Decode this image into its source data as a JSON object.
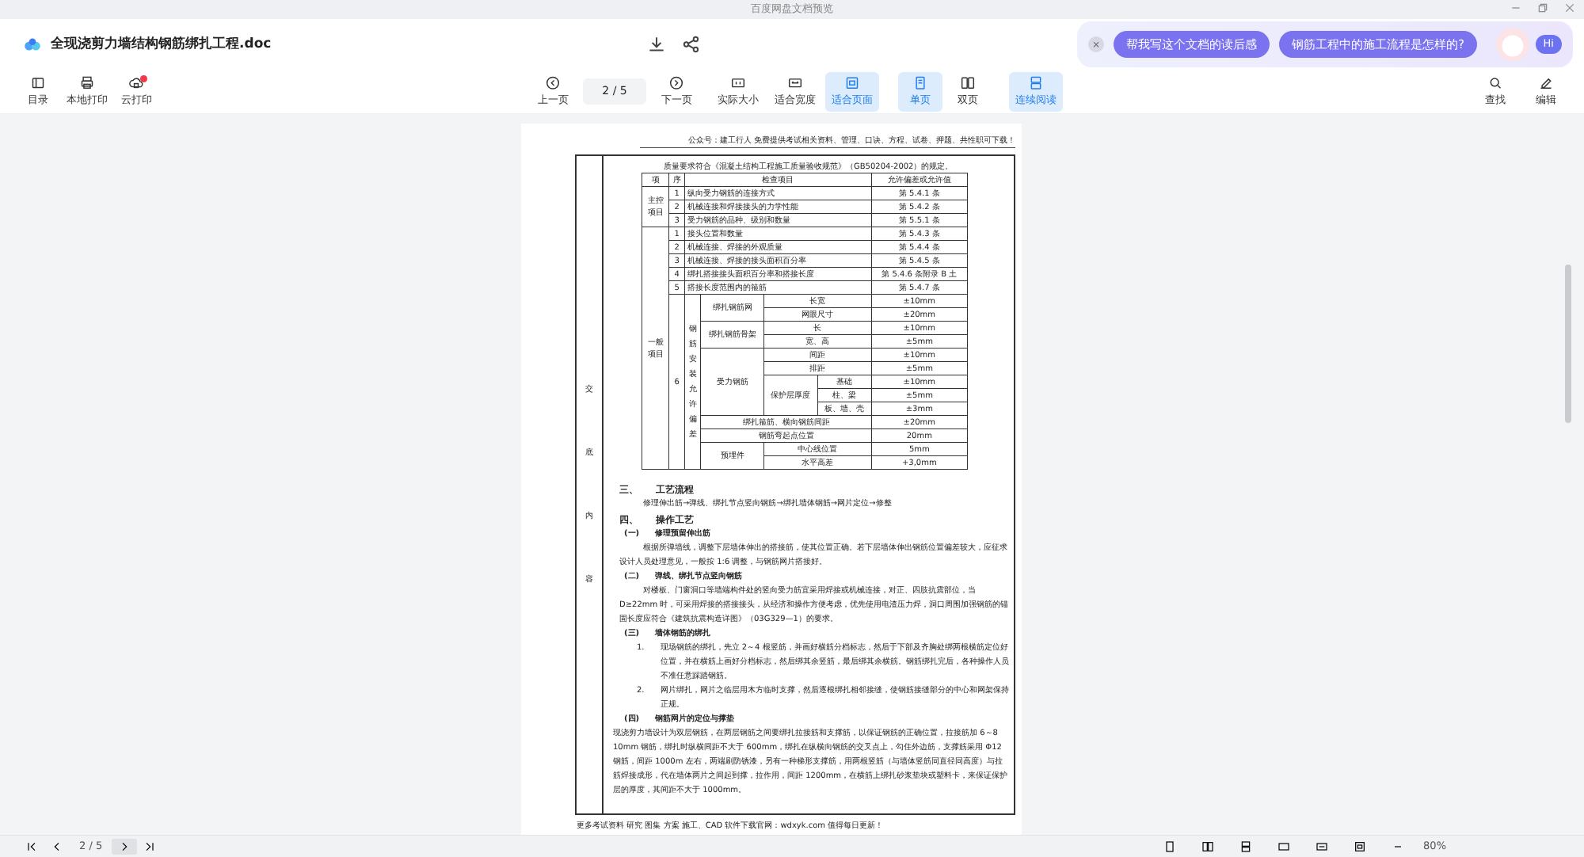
{
  "window": {
    "title": "百度网盘文档预览"
  },
  "file": {
    "name": "全现浇剪力墙结构钢筋绑扎工程.doc"
  },
  "assistant": {
    "close": "×",
    "suggestions": [
      "帮我写这个文档的读后感",
      "钢筋工程中的施工流程是怎样的?"
    ],
    "greeting": "Hi"
  },
  "toolbar": {
    "left": [
      {
        "label": "目录",
        "notification": false
      },
      {
        "label": "本地打印",
        "notification": false
      },
      {
        "label": "云打印",
        "notification": true
      }
    ],
    "nav": {
      "prev": "上一页",
      "page": "2 / 5",
      "next": "下一页"
    },
    "view": [
      {
        "label": "实际大小",
        "selected": false
      },
      {
        "label": "适合宽度",
        "selected": false
      },
      {
        "label": "适合页面",
        "selected": true
      }
    ],
    "layout": [
      {
        "label": "单页",
        "selected": true
      },
      {
        "label": "双页",
        "selected": false
      }
    ],
    "continuous": {
      "label": "连续阅读",
      "selected": true
    },
    "right": [
      {
        "label": "查找"
      },
      {
        "label": "编辑"
      }
    ]
  },
  "document": {
    "header_note": "公众号：建工行人 免费提供考试相关资料、管理、口诀、方程、试卷、押题、共性职可下载！",
    "side_label": "交底内容",
    "quality_table": {
      "caption": "质量要求符合《混凝土结构工程施工质量验收规范》（GB50204-2002）的规定。",
      "columns": [
        "项",
        "序",
        "检查项目",
        "允许偏差或允许值"
      ],
      "groups": [
        {
          "name": "主控项目",
          "items": [
            {
              "seq": "1",
              "item": "纵向受力钢筋的连接方式",
              "value": "第 5.4.1 条"
            },
            {
              "seq": "2",
              "item": "机械连接和焊接接头的力学性能",
              "value": "第 5.4.2 条"
            },
            {
              "seq": "3",
              "item": "受力钢筋的品种、级别和数量",
              "value": "第 5.5.1 条"
            }
          ]
        },
        {
          "name": "一般项目",
          "items": [
            {
              "seq": "1",
              "item": "接头位置和数量",
              "value": "第 5.4.3 条"
            },
            {
              "seq": "2",
              "item": "机械连接、焊接的外观质量",
              "value": "第 5.4.4 条"
            },
            {
              "seq": "3",
              "item": "机械连接、焊接的接头面积百分率",
              "value": "第 5.4.5 条"
            },
            {
              "seq": "4",
              "item": "绑扎搭接接头面积百分率和搭接长度",
              "value": "第 5.4.6 条附录 B 土"
            },
            {
              "seq": "5",
              "item": "搭接长度范围内的箍筋",
              "value": "第 5.4.7 条"
            },
            {
              "seq": "6",
              "item": "钢筋安装允许偏差",
              "children": [
                {
                  "item": "绑扎钢筋网",
                  "children": [
                    {
                      "item": "长宽",
                      "value": "±10mm"
                    },
                    {
                      "item": "网眼尺寸",
                      "value": "±20mm"
                    }
                  ]
                },
                {
                  "item": "绑扎钢筋骨架",
                  "children": [
                    {
                      "item": "长",
                      "value": "±10mm"
                    },
                    {
                      "item": "宽、高",
                      "value": "±5mm"
                    }
                  ]
                },
                {
                  "item": "受力钢筋",
                  "children": [
                    {
                      "item": "间距",
                      "value": "±10mm"
                    },
                    {
                      "item": "排距",
                      "value": "±5mm"
                    },
                    {
                      "item": "保护层厚度",
                      "children": [
                        {
                          "item": "基础",
                          "value": "±10mm"
                        },
                        {
                          "item": "柱、梁",
                          "value": "±5mm"
                        },
                        {
                          "item": "板、墙、壳",
                          "value": "±3mm"
                        }
                      ]
                    }
                  ]
                },
                {
                  "item": "绑扎箍筋、横向钢筋间距",
                  "value": "±20mm"
                },
                {
                  "item": "钢筋弯起点位置",
                  "value": "20mm"
                },
                {
                  "item": "预埋件",
                  "children": [
                    {
                      "item": "中心线位置",
                      "value": "5mm"
                    },
                    {
                      "item": "水平高差",
                      "value": "+3,0mm"
                    }
                  ]
                }
              ]
            }
          ]
        }
      ]
    },
    "sections": [
      {
        "kind": "heading",
        "number": "三、",
        "title": "工艺流程"
      },
      {
        "kind": "paragraph",
        "text": "修理伸出筋→弹线、绑扎节点竖向钢筋→绑扎墙体钢筋→网片定位→修整"
      },
      {
        "kind": "heading",
        "number": "四、",
        "title": "操作工艺"
      },
      {
        "kind": "subheading",
        "number": "(一)",
        "title": "修理预留伸出筋"
      },
      {
        "kind": "paragraph",
        "text": "根据所弹墙线，调整下层墙体伸出的搭接筋，使其位置正确。若下层墙体伸出钢筋位置偏差较大，应征求设计人员处理意见，一般按 1:6 调整，与钢筋网片搭接好。"
      },
      {
        "kind": "subheading",
        "number": "(二)",
        "title": "弹线、绑扎节点竖向钢筋"
      },
      {
        "kind": "paragraph",
        "text": "对楼板、门窗洞口等墙端构件处的竖向受力筋宜采用焊接或机械连接，对正、四肢抗震部位，当 D≥22mm 时，可采用焊接的搭接接头，从经济和操作方便考虑，优先使用电渣压力焊，洞口周围加强钢筋的锚固长度应符合《建筑抗震构造详图》（03G329—1）的要求。"
      },
      {
        "kind": "subheading",
        "number": "(三)",
        "title": "墙体钢筋的绑扎"
      },
      {
        "kind": "numbered",
        "number": "1.",
        "text": "现场钢筋的绑扎，先立 2～4 根竖筋，并画好横筋分档标志，然后于下部及齐胸处绑两根横筋定位好位置，并在横筋上画好分档标志，然后绑其余竖筋，最后绑其余横筋。钢筋绑扎完后，各种操作人员不准任意踩踏钢筋。"
      },
      {
        "kind": "numbered",
        "number": "2.",
        "text": "网片绑扎，网片之临层用木方临时支撑，然后逐根绑扎相邻接缝，使钢筋接缝部分的中心和网架保持正规。"
      },
      {
        "kind": "subheading",
        "number": "(四)",
        "title": "钢筋网片的定位与撑垫"
      },
      {
        "kind": "block",
        "text": "现浇剪力墙设计为双层钢筋，在两层钢筋之间要绑扎拉接筋和支撑筋，以保证钢筋的正确位置，拉接筋加 6～8 10mm 钢筋，绑扎时纵横间距不大于 600mm，绑扎在纵横向钢筋的交叉点上，勾住外边筋，支撑筋采用 Φ12 钢筋，间距 1000m 左右，两端刷防锈漆，另有一种梯形支撑筋，用两根竖筋（与墙体竖筋同直径同高度）与拉筋焊接成形，代在墙体两片之间起到撑，拉作用，间距 1200mm，在横筋上绑扎砂浆垫块或塑料卡，来保证保护层的厚度，其间距不大于 1000mm。"
      }
    ],
    "footer": "更多考试资料 研究 图集 方案 施工、CAD 软件下载官网：wdxyk.com 值得每日更新！"
  },
  "pager": {
    "page": "2 / 5"
  },
  "zoom": "80%"
}
